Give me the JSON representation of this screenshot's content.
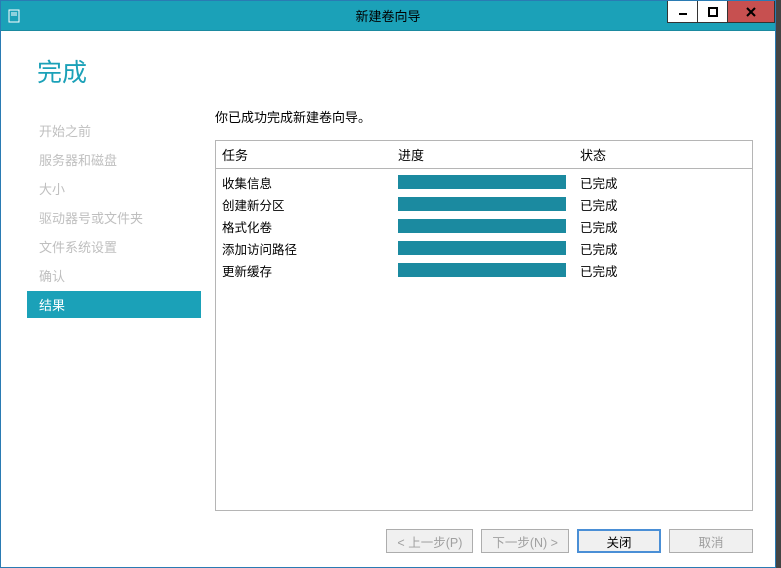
{
  "titlebar": {
    "title": "新建卷向导"
  },
  "heading": "完成",
  "sidebar": {
    "items": [
      {
        "label": "开始之前"
      },
      {
        "label": "服务器和磁盘"
      },
      {
        "label": "大小"
      },
      {
        "label": "驱动器号或文件夹"
      },
      {
        "label": "文件系统设置"
      },
      {
        "label": "确认"
      },
      {
        "label": "结果"
      }
    ]
  },
  "main": {
    "summary": "你已成功完成新建卷向导。",
    "columns": {
      "task": "任务",
      "progress": "进度",
      "status": "状态"
    },
    "rows": [
      {
        "task": "收集信息",
        "status": "已完成"
      },
      {
        "task": "创建新分区",
        "status": "已完成"
      },
      {
        "task": "格式化卷",
        "status": "已完成"
      },
      {
        "task": "添加访问路径",
        "status": "已完成"
      },
      {
        "task": "更新缓存",
        "status": "已完成"
      }
    ]
  },
  "buttons": {
    "prev": "< 上一步(P)",
    "next": "下一步(N) >",
    "close": "关闭",
    "cancel": "取消"
  }
}
